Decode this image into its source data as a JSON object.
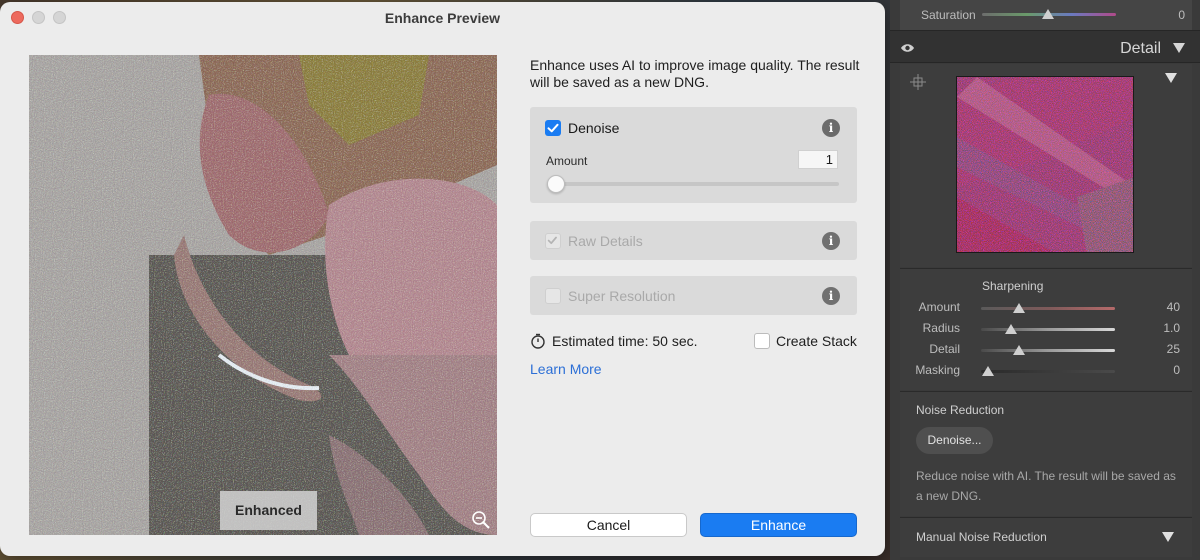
{
  "dialog": {
    "title": "Enhance Preview",
    "description": "Enhance uses AI to improve image quality. The result will be saved as a new DNG.",
    "preview_badge": "Enhanced",
    "options": {
      "denoise": {
        "label": "Denoise",
        "checked": true,
        "amount_label": "Amount",
        "amount_value": "1"
      },
      "raw_details": {
        "label": "Raw Details",
        "checked": true,
        "disabled": true
      },
      "super_resolution": {
        "label": "Super Resolution",
        "checked": false,
        "disabled": true
      }
    },
    "estimated_time": "Estimated time: 50 sec.",
    "create_stack_label": "Create Stack",
    "learn_more": "Learn More",
    "cancel_label": "Cancel",
    "enhance_label": "Enhance",
    "colors": {
      "accent": "#1a7cf2",
      "link": "#2c6fd6"
    }
  },
  "panel": {
    "saturation": {
      "label": "Saturation",
      "value": "0"
    },
    "detail_title": "Detail",
    "sharpening": {
      "title": "Sharpening",
      "sliders": [
        {
          "label": "Amount",
          "value": "40"
        },
        {
          "label": "Radius",
          "value": "1.0"
        },
        {
          "label": "Detail",
          "value": "25"
        },
        {
          "label": "Masking",
          "value": "0"
        }
      ]
    },
    "noise_reduction": {
      "title": "Noise Reduction",
      "button": "Denoise...",
      "description": "Reduce noise with AI. The result will be saved as a new DNG."
    },
    "manual_noise_reduction": "Manual Noise Reduction"
  }
}
